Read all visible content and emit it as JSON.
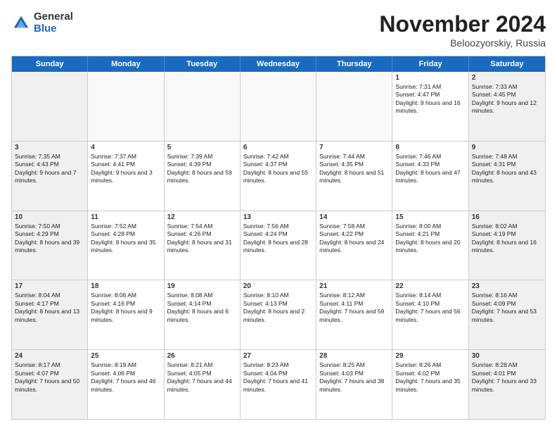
{
  "logo": {
    "general": "General",
    "blue": "Blue"
  },
  "title": "November 2024",
  "location": "Beloozyorskiy, Russia",
  "header": {
    "days": [
      "Sunday",
      "Monday",
      "Tuesday",
      "Wednesday",
      "Thursday",
      "Friday",
      "Saturday"
    ]
  },
  "rows": [
    [
      {
        "day": "",
        "info": ""
      },
      {
        "day": "",
        "info": ""
      },
      {
        "day": "",
        "info": ""
      },
      {
        "day": "",
        "info": ""
      },
      {
        "day": "",
        "info": ""
      },
      {
        "day": "1",
        "info": "Sunrise: 7:31 AM\nSunset: 4:47 PM\nDaylight: 9 hours and 16 minutes."
      },
      {
        "day": "2",
        "info": "Sunrise: 7:33 AM\nSunset: 4:45 PM\nDaylight: 9 hours and 12 minutes."
      }
    ],
    [
      {
        "day": "3",
        "info": "Sunrise: 7:35 AM\nSunset: 4:43 PM\nDaylight: 9 hours and 7 minutes."
      },
      {
        "day": "4",
        "info": "Sunrise: 7:37 AM\nSunset: 4:41 PM\nDaylight: 9 hours and 3 minutes."
      },
      {
        "day": "5",
        "info": "Sunrise: 7:39 AM\nSunset: 4:39 PM\nDaylight: 8 hours and 59 minutes."
      },
      {
        "day": "6",
        "info": "Sunrise: 7:42 AM\nSunset: 4:37 PM\nDaylight: 8 hours and 55 minutes."
      },
      {
        "day": "7",
        "info": "Sunrise: 7:44 AM\nSunset: 4:35 PM\nDaylight: 8 hours and 51 minutes."
      },
      {
        "day": "8",
        "info": "Sunrise: 7:46 AM\nSunset: 4:33 PM\nDaylight: 8 hours and 47 minutes."
      },
      {
        "day": "9",
        "info": "Sunrise: 7:48 AM\nSunset: 4:31 PM\nDaylight: 8 hours and 43 minutes."
      }
    ],
    [
      {
        "day": "10",
        "info": "Sunrise: 7:50 AM\nSunset: 4:29 PM\nDaylight: 8 hours and 39 minutes."
      },
      {
        "day": "11",
        "info": "Sunrise: 7:52 AM\nSunset: 4:28 PM\nDaylight: 8 hours and 35 minutes."
      },
      {
        "day": "12",
        "info": "Sunrise: 7:54 AM\nSunset: 4:26 PM\nDaylight: 8 hours and 31 minutes."
      },
      {
        "day": "13",
        "info": "Sunrise: 7:56 AM\nSunset: 4:24 PM\nDaylight: 8 hours and 28 minutes."
      },
      {
        "day": "14",
        "info": "Sunrise: 7:58 AM\nSunset: 4:22 PM\nDaylight: 8 hours and 24 minutes."
      },
      {
        "day": "15",
        "info": "Sunrise: 8:00 AM\nSunset: 4:21 PM\nDaylight: 8 hours and 20 minutes."
      },
      {
        "day": "16",
        "info": "Sunrise: 8:02 AM\nSunset: 4:19 PM\nDaylight: 8 hours and 16 minutes."
      }
    ],
    [
      {
        "day": "17",
        "info": "Sunrise: 8:04 AM\nSunset: 4:17 PM\nDaylight: 8 hours and 13 minutes."
      },
      {
        "day": "18",
        "info": "Sunrise: 8:06 AM\nSunset: 4:16 PM\nDaylight: 8 hours and 9 minutes."
      },
      {
        "day": "19",
        "info": "Sunrise: 8:08 AM\nSunset: 4:14 PM\nDaylight: 8 hours and 6 minutes."
      },
      {
        "day": "20",
        "info": "Sunrise: 8:10 AM\nSunset: 4:13 PM\nDaylight: 8 hours and 2 minutes."
      },
      {
        "day": "21",
        "info": "Sunrise: 8:12 AM\nSunset: 4:11 PM\nDaylight: 7 hours and 59 minutes."
      },
      {
        "day": "22",
        "info": "Sunrise: 8:14 AM\nSunset: 4:10 PM\nDaylight: 7 hours and 56 minutes."
      },
      {
        "day": "23",
        "info": "Sunrise: 8:16 AM\nSunset: 4:09 PM\nDaylight: 7 hours and 53 minutes."
      }
    ],
    [
      {
        "day": "24",
        "info": "Sunrise: 8:17 AM\nSunset: 4:07 PM\nDaylight: 7 hours and 50 minutes."
      },
      {
        "day": "25",
        "info": "Sunrise: 8:19 AM\nSunset: 4:06 PM\nDaylight: 7 hours and 46 minutes."
      },
      {
        "day": "26",
        "info": "Sunrise: 8:21 AM\nSunset: 4:05 PM\nDaylight: 7 hours and 44 minutes."
      },
      {
        "day": "27",
        "info": "Sunrise: 8:23 AM\nSunset: 4:04 PM\nDaylight: 7 hours and 41 minutes."
      },
      {
        "day": "28",
        "info": "Sunrise: 8:25 AM\nSunset: 4:03 PM\nDaylight: 7 hours and 38 minutes."
      },
      {
        "day": "29",
        "info": "Sunrise: 8:26 AM\nSunset: 4:02 PM\nDaylight: 7 hours and 35 minutes."
      },
      {
        "day": "30",
        "info": "Sunrise: 8:28 AM\nSunset: 4:01 PM\nDaylight: 7 hours and 33 minutes."
      }
    ]
  ]
}
